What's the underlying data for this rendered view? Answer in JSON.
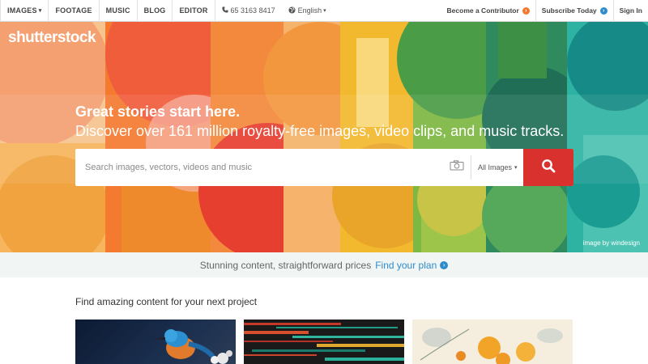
{
  "nav": {
    "items": [
      {
        "label": "IMAGES",
        "caret": "▾"
      },
      {
        "label": "FOOTAGE"
      },
      {
        "label": "MUSIC"
      },
      {
        "label": "BLOG"
      },
      {
        "label": "EDITOR"
      }
    ],
    "phone": "65 3163 8417",
    "language": "English",
    "language_caret": "▾",
    "become_contributor": "Become a Contributor",
    "subscribe_today": "Subscribe Today",
    "sign_in": "Sign In"
  },
  "hero": {
    "logo": "shutterstock",
    "headline_line1": "Great stories start here.",
    "headline_line2": "Discover over 161 million royalty-free images, video clips, and music tracks.",
    "search_placeholder": "Search images, vectors, videos and music",
    "filter_label": "All Images",
    "filter_caret": "▾",
    "credit": "image by windesign"
  },
  "promo": {
    "text": "Stunning content, straightforward prices",
    "link": "Find your plan"
  },
  "content": {
    "section_title": "Find amazing content for your next project"
  },
  "icons": {
    "phone": "phone-icon",
    "globe": "globe-icon",
    "camera": "camera-icon",
    "search": "search-icon"
  },
  "colors": {
    "accent_red": "#d9322e",
    "link_blue": "#2e8ccc",
    "contributor_orange": "#f2782f"
  }
}
